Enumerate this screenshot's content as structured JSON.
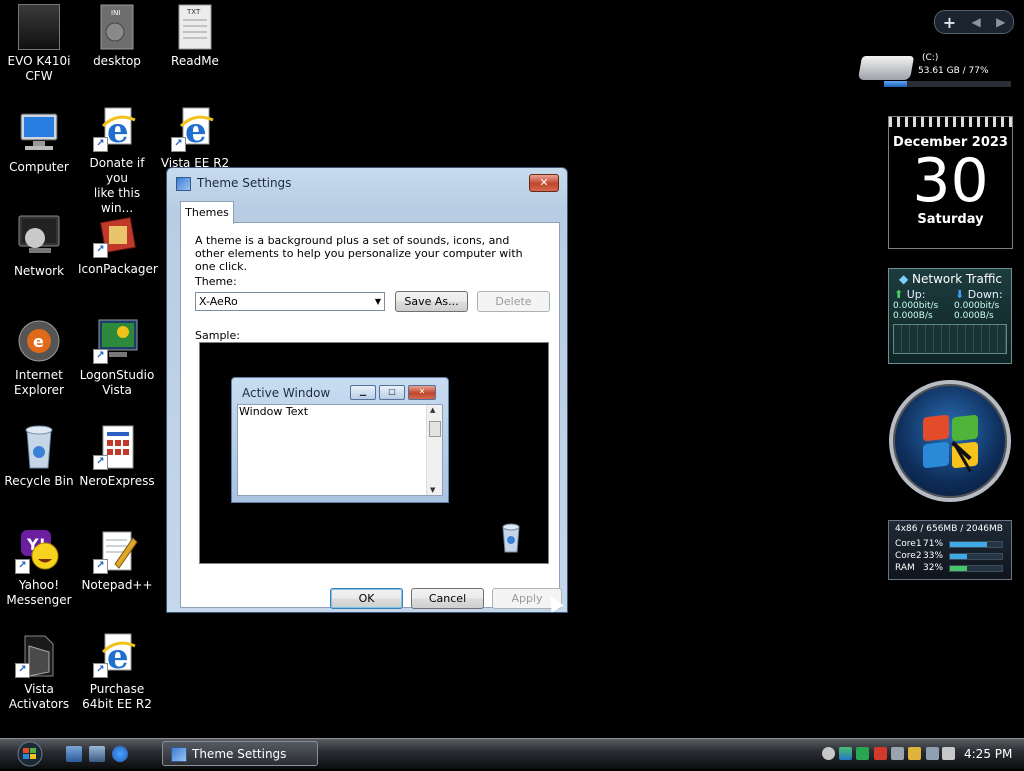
{
  "desktop": {
    "icons": [
      {
        "label": "EVO K410i CFW",
        "lines": [
          "EVO K410i",
          "CFW"
        ]
      },
      {
        "label": "desktop"
      },
      {
        "label": "ReadMe",
        "badge": "TXT"
      },
      {
        "label": "Computer"
      },
      {
        "label": "Donate if you like this win...",
        "lines": [
          "Donate if you",
          "like this win..."
        ]
      },
      {
        "label": "Vista EE R2"
      },
      {
        "label": "Network"
      },
      {
        "label": "IconPackager"
      },
      {
        "label": "Internet Explorer",
        "lines": [
          "Internet",
          "Explorer"
        ]
      },
      {
        "label": "LogonStudio Vista",
        "lines": [
          "LogonStudio",
          "Vista"
        ]
      },
      {
        "label": "Recycle Bin"
      },
      {
        "label": "NeroExpress"
      },
      {
        "label": "Yahoo! Messenger",
        "lines": [
          "Yahoo!",
          "Messenger"
        ]
      },
      {
        "label": "Notepad++"
      },
      {
        "label": "Vista Activators",
        "lines": [
          "Vista",
          "Activators"
        ]
      },
      {
        "label": "Purchase 64bit EE R2",
        "lines": [
          "Purchase",
          "64bit EE R2"
        ]
      }
    ]
  },
  "gadgets": {
    "toolbar": {
      "add": "+",
      "prev": "◀",
      "next": "▶"
    },
    "drive": {
      "name": "(C:)",
      "usage": "53.61 GB / 77%",
      "used_fraction": 0.18
    },
    "calendar": {
      "month": "December 2023",
      "day": "30",
      "weekday": "Saturday"
    },
    "network": {
      "title": "Network Traffic",
      "up_label": "Up:",
      "down_label": "Down:",
      "up_bits": "0.000bit/s",
      "down_bits": "0.000bit/s",
      "up_bytes": "0.000B/s",
      "down_bytes": "0.000B/s"
    },
    "cpu": {
      "header": "4x86 / 656MB / 2046MB",
      "rows": [
        {
          "name": "Core1",
          "pct": "71%",
          "value": 71,
          "color": "#3fa9e6"
        },
        {
          "name": "Core2",
          "pct": "33%",
          "value": 33,
          "color": "#3fa9e6"
        },
        {
          "name": "RAM",
          "pct": "32%",
          "value": 32,
          "color": "#46c46a"
        }
      ]
    }
  },
  "dialog": {
    "title": "Theme Settings",
    "close": "✕",
    "tab": "Themes",
    "description": "A theme is a background plus a set of sounds, icons, and other elements to help you personalize your computer with one click.",
    "theme_label": "Theme:",
    "theme_value": "X-AeRo",
    "save_as": "Save As...",
    "delete": "Delete",
    "sample_label": "Sample:",
    "sample": {
      "window_title": "Active Window",
      "window_text": "Window Text"
    },
    "ok": "OK",
    "cancel": "Cancel",
    "apply": "Apply"
  },
  "taskbar": {
    "task_title": "Theme Settings",
    "clock": "4:25 PM"
  },
  "colors": {
    "accent": "#1d5fb6",
    "desktop": "#000000"
  }
}
